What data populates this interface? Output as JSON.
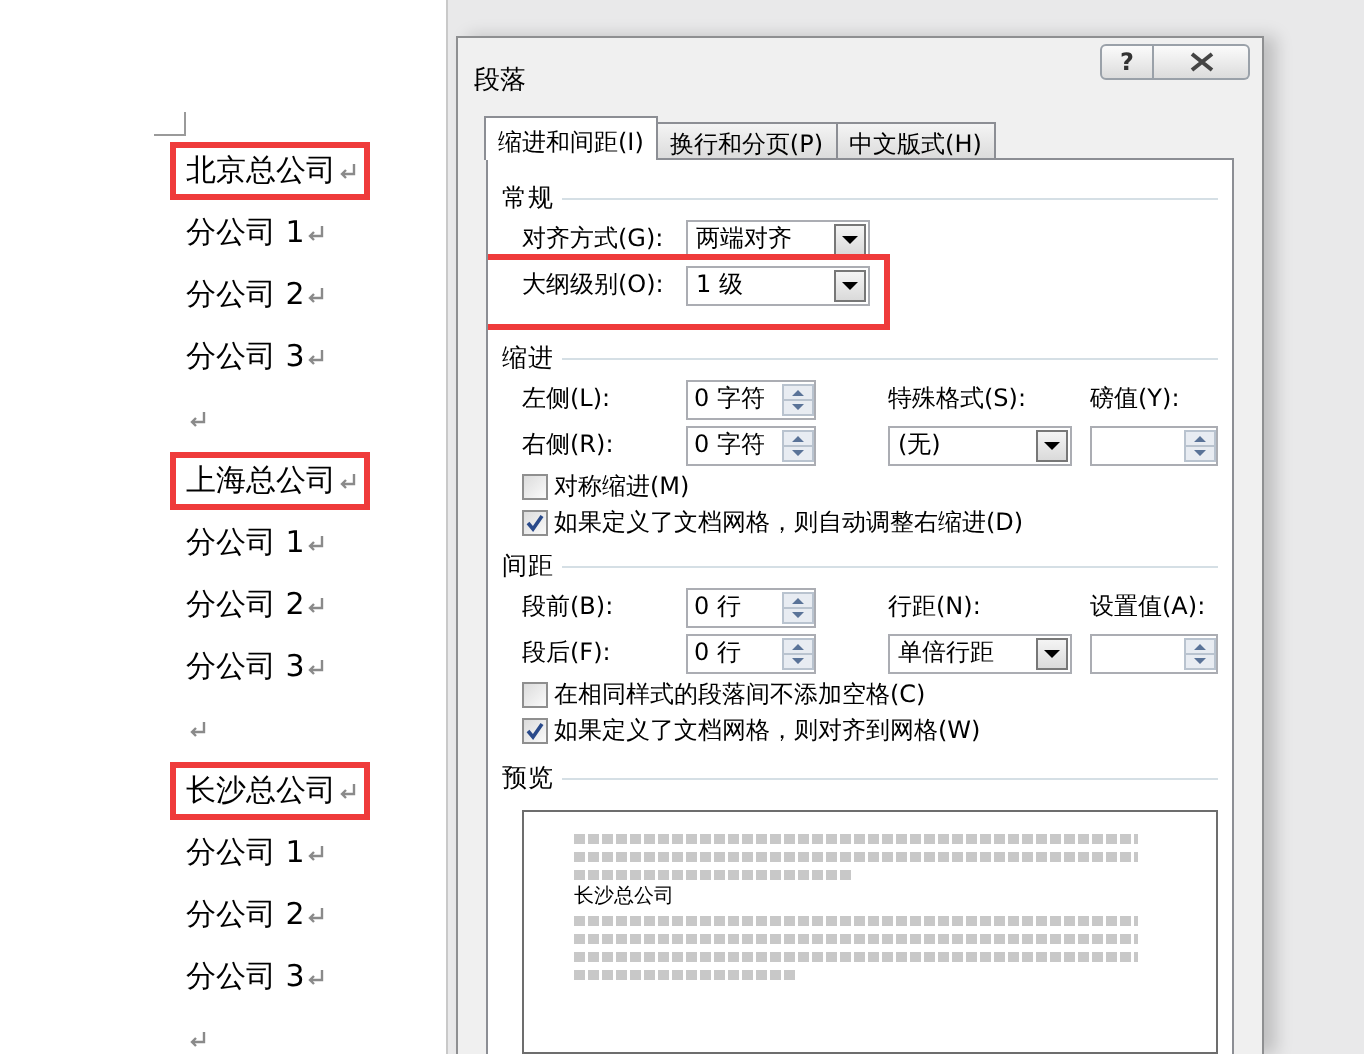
{
  "document": {
    "paragraphs": [
      {
        "kind": "text",
        "text": "北京总公司",
        "highlighted": true
      },
      {
        "kind": "text",
        "text": "分公司 1",
        "highlighted": false
      },
      {
        "kind": "text",
        "text": "分公司 2",
        "highlighted": false
      },
      {
        "kind": "text",
        "text": "分公司 3",
        "highlighted": false
      },
      {
        "kind": "empty",
        "highlighted": false
      },
      {
        "kind": "text",
        "text": "上海总公司",
        "highlighted": true
      },
      {
        "kind": "text",
        "text": "分公司 1",
        "highlighted": false
      },
      {
        "kind": "text",
        "text": "分公司 2",
        "highlighted": false
      },
      {
        "kind": "text",
        "text": "分公司 3",
        "highlighted": false
      },
      {
        "kind": "empty",
        "highlighted": false
      },
      {
        "kind": "text",
        "text": "长沙总公司",
        "highlighted": true
      },
      {
        "kind": "text",
        "text": "分公司 1",
        "highlighted": false
      },
      {
        "kind": "text",
        "text": "分公司 2",
        "highlighted": false
      },
      {
        "kind": "text",
        "text": "分公司 3",
        "highlighted": false
      },
      {
        "kind": "empty",
        "highlighted": false
      }
    ]
  },
  "dialog": {
    "title": "段落",
    "help_button": "?",
    "tabs": [
      {
        "label": "缩进和间距(I)",
        "selected": true
      },
      {
        "label": "换行和分页(P)",
        "selected": false
      },
      {
        "label": "中文版式(H)",
        "selected": false
      }
    ],
    "sections": [
      {
        "title": "常规",
        "rows": [
          {
            "kind": "grid",
            "highlighted": false,
            "cells": [
              {
                "kind": "label",
                "text": "对齐方式(G):"
              },
              {
                "kind": "dropdown",
                "value": "两端对齐"
              }
            ]
          },
          {
            "kind": "grid",
            "highlighted": true,
            "cells": [
              {
                "kind": "label",
                "text": "大纲级别(O):"
              },
              {
                "kind": "dropdown",
                "value": "1 级"
              }
            ]
          }
        ]
      },
      {
        "title": "缩进",
        "rows": [
          {
            "kind": "grid",
            "highlighted": false,
            "cells": [
              {
                "kind": "label",
                "text": "左侧(L):"
              },
              {
                "kind": "spin",
                "value": "0 字符"
              },
              {
                "kind": "label",
                "text": "特殊格式(S):"
              },
              {
                "kind": "label",
                "text": "磅值(Y):"
              }
            ]
          },
          {
            "kind": "grid",
            "highlighted": false,
            "cells": [
              {
                "kind": "label",
                "text": "右侧(R):"
              },
              {
                "kind": "spin",
                "value": "0 字符"
              },
              {
                "kind": "dropdown",
                "value": "(无)"
              },
              {
                "kind": "spin"
              }
            ]
          },
          {
            "kind": "checkbox",
            "label": "对称缩进(M)",
            "checked": false
          },
          {
            "kind": "checkbox",
            "label": "如果定义了文档网格，则自动调整右缩进(D)",
            "checked": true
          }
        ]
      },
      {
        "title": "间距",
        "rows": [
          {
            "kind": "grid",
            "highlighted": false,
            "cells": [
              {
                "kind": "label",
                "text": "段前(B):"
              },
              {
                "kind": "spin",
                "value": "0 行"
              },
              {
                "kind": "label",
                "text": "行距(N):"
              },
              {
                "kind": "label",
                "text": "设置值(A):"
              }
            ]
          },
          {
            "kind": "grid",
            "highlighted": false,
            "cells": [
              {
                "kind": "label",
                "text": "段后(F):"
              },
              {
                "kind": "spin",
                "value": "0 行"
              },
              {
                "kind": "dropdown",
                "value": "单倍行距"
              },
              {
                "kind": "spin"
              }
            ]
          },
          {
            "kind": "checkbox",
            "label": "在相同样式的段落间不添加空格(C)",
            "checked": false
          },
          {
            "kind": "checkbox",
            "label": "如果定义了文档网格，则对齐到网格(W)",
            "checked": true
          }
        ]
      }
    ],
    "preview": {
      "title": "预览",
      "current_text": "长沙总公司"
    }
  }
}
